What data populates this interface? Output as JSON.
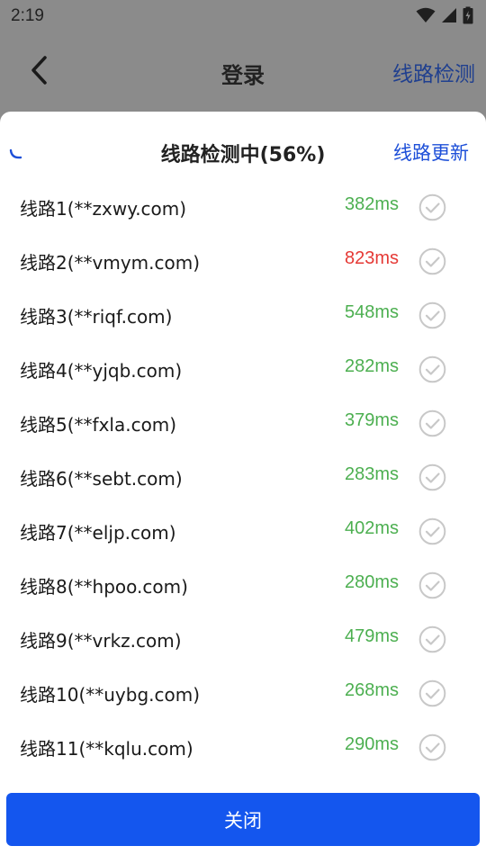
{
  "status_bar": {
    "time": "2:19",
    "icons": [
      "wifi-icon",
      "signal-icon",
      "battery-icon"
    ]
  },
  "header": {
    "title": "登录",
    "right_link": "线路检测",
    "back_icon": "back-arrow-icon"
  },
  "sheet": {
    "title": "线路检测中(56%)",
    "progress_percent": 56,
    "refresh_label": "线路更新",
    "routes": [
      {
        "name": "线路1(**zxwy.com)",
        "latency": "382ms",
        "status": "good"
      },
      {
        "name": "线路2(**vmym.com)",
        "latency": "823ms",
        "status": "slow"
      },
      {
        "name": "线路3(**riqf.com)",
        "latency": "548ms",
        "status": "good"
      },
      {
        "name": "线路4(**yjqb.com)",
        "latency": "282ms",
        "status": "good"
      },
      {
        "name": "线路5(**fxla.com)",
        "latency": "379ms",
        "status": "good"
      },
      {
        "name": "线路6(**sebt.com)",
        "latency": "283ms",
        "status": "good"
      },
      {
        "name": "线路7(**eljp.com)",
        "latency": "402ms",
        "status": "good"
      },
      {
        "name": "线路8(**hpoo.com)",
        "latency": "280ms",
        "status": "good"
      },
      {
        "name": "线路9(**vrkz.com)",
        "latency": "479ms",
        "status": "good"
      },
      {
        "name": "线路10(**uybg.com)",
        "latency": "268ms",
        "status": "good"
      },
      {
        "name": "线路11(**kqlu.com)",
        "latency": "290ms",
        "status": "good"
      }
    ],
    "close_label": "关闭"
  },
  "colors": {
    "accent": "#1456ee",
    "link": "#1d4fd8",
    "good": "#4caf50",
    "slow": "#e53935",
    "overlay": "#8b8b8b",
    "check": "#c8c8c8"
  }
}
